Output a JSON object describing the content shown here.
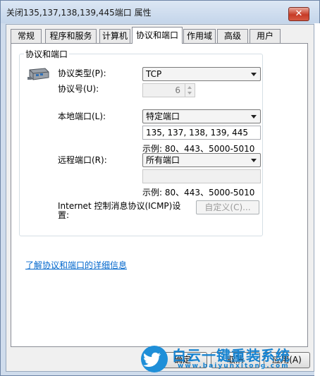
{
  "window": {
    "title": "关闭135,137,138,139,445端口 属性",
    "close_glyph": "✕"
  },
  "tabs": [
    {
      "label": "常规"
    },
    {
      "label": "程序和服务"
    },
    {
      "label": "计算机"
    },
    {
      "label": "协议和端口"
    },
    {
      "label": "作用域"
    },
    {
      "label": "高级"
    },
    {
      "label": "用户"
    }
  ],
  "group": {
    "title": "协议和端口",
    "protocol_type_label": "协议类型(P):",
    "protocol_type_value": "TCP",
    "protocol_number_label": "协议号(U):",
    "protocol_number_value": "6",
    "local_port_label": "本地端口(L):",
    "local_port_value": "特定端口",
    "local_port_text": "135, 137, 138, 139, 445",
    "local_port_example": "示例: 80、443、5000-5010",
    "remote_port_label": "远程端口(R):",
    "remote_port_value": "所有端口",
    "remote_port_text": "",
    "remote_port_example": "示例: 80、443、5000-5010",
    "icmp_label_line1": "Internet 控制消息协议(ICMP)设",
    "icmp_label_line2": "置:",
    "customize_button": "自定义(C)..."
  },
  "link_text": "了解协议和端口的详细信息",
  "buttons": {
    "ok": "确定",
    "cancel": "取消",
    "apply": "应用(A)"
  },
  "watermark": {
    "text": "白云一键重装系统",
    "url": "www.baiyunxitong.com"
  },
  "icons": {
    "network": "network-adapter-icon",
    "bird": "twitter-bird-icon"
  }
}
